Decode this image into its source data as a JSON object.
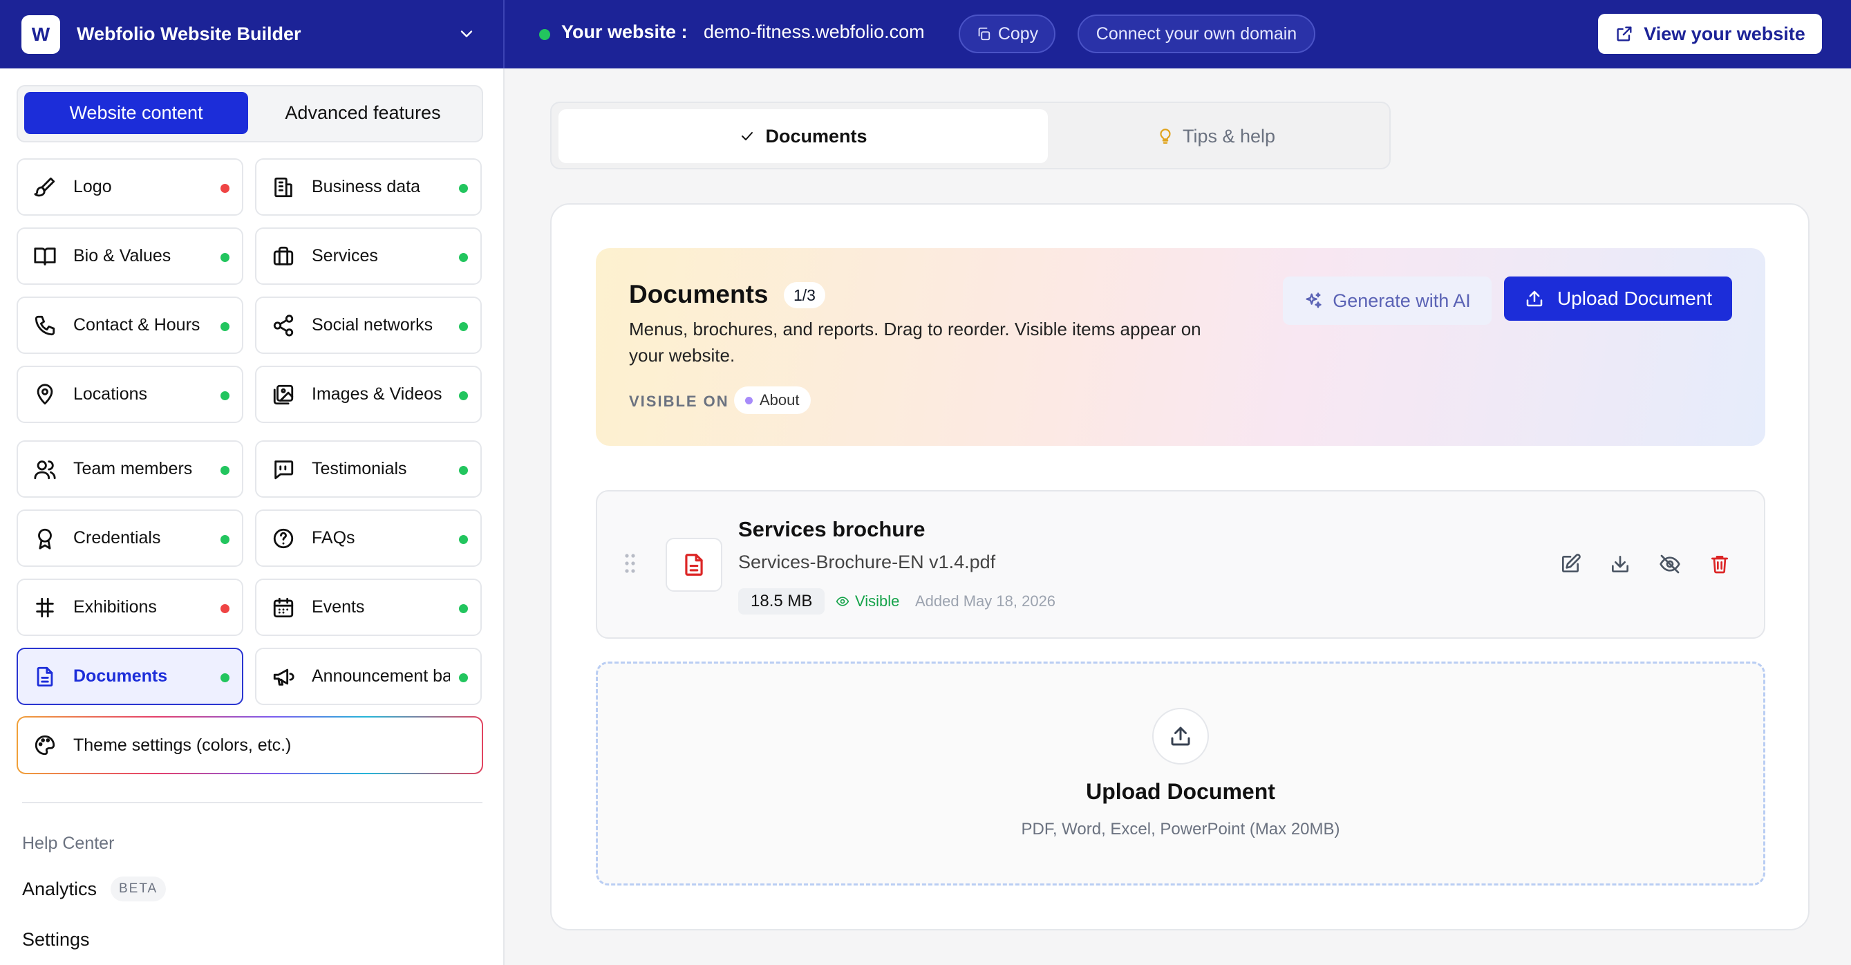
{
  "topbar": {
    "brand_initial": "W",
    "brand_name": "Webfolio Website Builder",
    "site_label": "Your website :",
    "site_url": "demo-fitness.webfolio.com",
    "copy_label": "Copy",
    "connect_label": "Connect your own domain",
    "view_label": "View your website"
  },
  "sidebar": {
    "tab_active": "Website content",
    "tab_other": "Advanced features",
    "items": [
      {
        "label": "Logo",
        "icon": "brush-icon",
        "status": "red"
      },
      {
        "label": "Business data",
        "icon": "building-icon",
        "status": "green"
      },
      {
        "label": "Bio & Values",
        "icon": "book-icon",
        "status": "green"
      },
      {
        "label": "Services",
        "icon": "briefcase-icon",
        "status": "green"
      },
      {
        "label": "Contact & Hours",
        "icon": "phone-icon",
        "status": "green"
      },
      {
        "label": "Social networks",
        "icon": "share-icon",
        "status": "green"
      },
      {
        "label": "Locations",
        "icon": "map-pin-icon",
        "status": "green"
      },
      {
        "label": "Images & Videos",
        "icon": "images-icon",
        "status": "green"
      },
      {
        "label": "Team members",
        "icon": "users-icon",
        "status": "green"
      },
      {
        "label": "Testimonials",
        "icon": "quote-icon",
        "status": "green"
      },
      {
        "label": "Credentials",
        "icon": "award-icon",
        "status": "green"
      },
      {
        "label": "FAQs",
        "icon": "help-circle-icon",
        "status": "green"
      },
      {
        "label": "Exhibitions",
        "icon": "hash-icon",
        "status": "red"
      },
      {
        "label": "Events",
        "icon": "calendar-icon",
        "status": "green"
      },
      {
        "label": "Documents",
        "icon": "file-text-icon",
        "status": "green"
      },
      {
        "label": "Announcement bar",
        "icon": "megaphone-icon",
        "status": "green"
      }
    ],
    "theme_label": "Theme settings (colors, etc.)",
    "help_center": "Help Center",
    "analytics": "Analytics",
    "beta": "BETA",
    "settings": "Settings"
  },
  "main": {
    "tab_docs": "Documents",
    "tab_tips": "Tips & help",
    "hero": {
      "title": "Documents",
      "count": "1/3",
      "description": "Menus, brochures, and reports. Drag to reorder. Visible items appear on your website.",
      "visible_on_label": "VISIBLE ON",
      "visible_on_page": "About",
      "generate_label": "Generate with AI",
      "upload_label": "Upload Document"
    },
    "document": {
      "title": "Services brochure",
      "filename": "Services-Brochure-EN v1.4.pdf",
      "size": "18.5 MB",
      "visibility": "Visible",
      "added": "Added May 18, 2026"
    },
    "dropzone": {
      "title": "Upload Document",
      "subtitle": "PDF, Word, Excel, PowerPoint (Max 20MB)"
    }
  },
  "colors": {
    "brand": "#1c2397",
    "accent": "#1c2dd9",
    "status_green": "#22c55e",
    "status_red": "#ef4444"
  }
}
